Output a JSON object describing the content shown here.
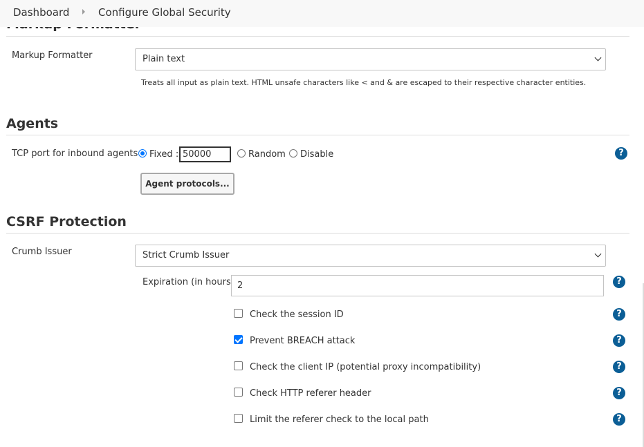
{
  "breadcrumb": {
    "items": [
      "Dashboard",
      "Configure Global Security"
    ]
  },
  "markup": {
    "section_title": "Markup Formatter",
    "label": "Markup Formatter",
    "selected": "Plain text",
    "description": "Treats all input as plain text. HTML unsafe characters like < and & are escaped to their respective character entities."
  },
  "agents": {
    "section_title": "Agents",
    "label": "TCP port for inbound agents",
    "option_fixed": "Fixed :",
    "fixed_port": "50000",
    "option_random": "Random",
    "option_disable": "Disable",
    "selected_option": "Fixed",
    "protocols_button": "Agent protocols..."
  },
  "csrf": {
    "section_title": "CSRF Protection",
    "label": "Crumb Issuer",
    "selected": "Strict Crumb Issuer",
    "expiration_label": "Expiration (in hours)",
    "expiration_value": "2",
    "checkboxes": [
      {
        "label": "Check the session ID",
        "checked": false
      },
      {
        "label": "Prevent BREACH attack",
        "checked": true
      },
      {
        "label": "Check the client IP (potential proxy incompatibility)",
        "checked": false
      },
      {
        "label": "Check HTTP referer header",
        "checked": false
      },
      {
        "label": "Limit the referer check to the local path",
        "checked": false
      }
    ]
  },
  "icons": {
    "help": "help-icon",
    "breadcrumb_separator": "chevron-right-icon",
    "dropdown": "chevron-down-icon"
  },
  "help_glyph": "?",
  "colors": {
    "accent": "#0075ff",
    "help_icon": "#0b5e96",
    "breadcrumb_bg": "#f8f8f8"
  }
}
